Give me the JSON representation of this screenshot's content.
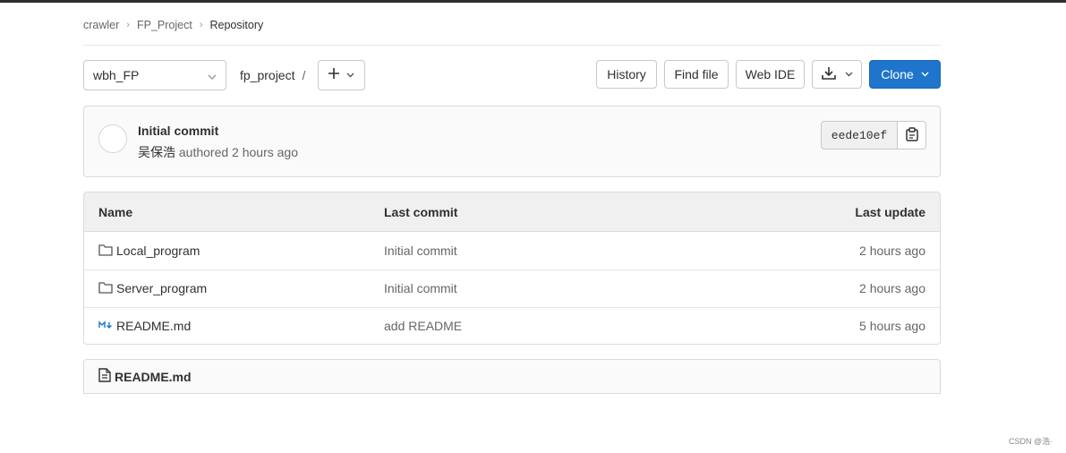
{
  "breadcrumb": {
    "items": [
      "crawler",
      "FP_Project"
    ],
    "current": "Repository"
  },
  "toolbar": {
    "branch": "wbh_FP",
    "path": "fp_project",
    "path_sep": "/",
    "history": "History",
    "find_file": "Find file",
    "web_ide": "Web IDE",
    "clone": "Clone"
  },
  "commit": {
    "title": "Initial commit",
    "author": "吴保浩",
    "meta": " authored 2 hours ago",
    "sha": "eede10ef"
  },
  "table": {
    "headers": {
      "name": "Name",
      "last_commit": "Last commit",
      "last_update": "Last update"
    },
    "rows": [
      {
        "icon": "folder-icon",
        "name": "Local_program",
        "commit": "Initial commit",
        "updated": "2 hours ago"
      },
      {
        "icon": "folder-icon",
        "name": "Server_program",
        "commit": "Initial commit",
        "updated": "2 hours ago"
      },
      {
        "icon": "markdown-icon",
        "name": "README.md",
        "commit": "add README",
        "updated": "5 hours ago"
      }
    ]
  },
  "readme": {
    "title": "README.md"
  },
  "watermark": "CSDN @浩·",
  "colors": {
    "primary": "#1f75cb",
    "border": "#dbdbdb",
    "header_bg": "#f0f0f0"
  }
}
